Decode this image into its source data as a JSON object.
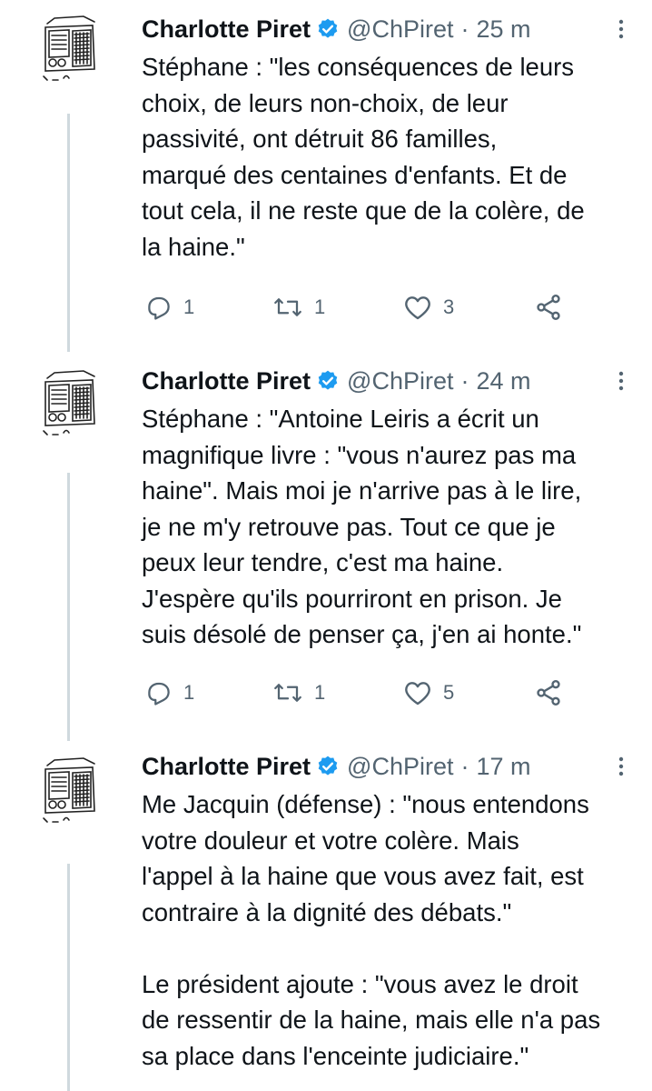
{
  "colors": {
    "text": "#0f1419",
    "secondary": "#536471",
    "verified": "#1d9bf0",
    "thread_line": "#cfd9de"
  },
  "tweets": [
    {
      "name": "Charlotte Piret",
      "handle": "@ChPiret",
      "separator": "·",
      "time": "25 m",
      "text": "Stéphane : \"les conséquences de leurs\nchoix, de leurs non-choix, de leur\npassivité, ont détruit 86 familles,\nmarqué des centaines d'enfants. Et de\ntout cela, il ne reste que de la colère, de\nla haine.\"",
      "replies": "1",
      "retweets": "1",
      "likes": "3"
    },
    {
      "name": "Charlotte Piret",
      "handle": "@ChPiret",
      "separator": "·",
      "time": "24 m",
      "text": "Stéphane : \"Antoine Leiris a écrit un\nmagnifique livre : \"vous n'aurez pas ma\nhaine\". Mais moi je n'arrive pas à le lire,\nje ne m'y retrouve pas. Tout ce que je\npeux leur tendre, c'est ma haine.\nJ'espère qu'ils pourriront en prison. Je\nsuis désolé de penser ça, j'en ai honte.\"",
      "replies": "1",
      "retweets": "1",
      "likes": "5"
    },
    {
      "name": "Charlotte Piret",
      "handle": "@ChPiret",
      "separator": "·",
      "time": "17 m",
      "text": "Me Jacquin (défense) : \"nous entendons\nvotre douleur et votre colère. Mais\nl'appel à la haine que vous avez fait, est\ncontraire à la dignité des débats.\"\n\nLe président ajoute : \"vous avez le droit\nde ressentir de la haine, mais elle n'a pas\nsa place dans l'enceinte judiciaire.\""
    }
  ]
}
